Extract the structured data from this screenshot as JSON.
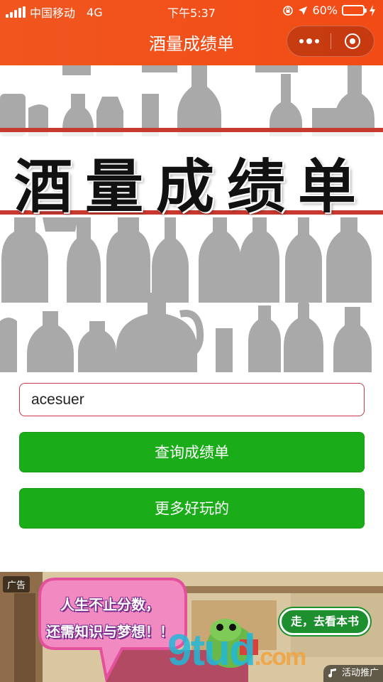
{
  "status_bar": {
    "carrier": "中国移动",
    "network": "4G",
    "time": "下午5:37",
    "battery_percent": "60%",
    "battery_level": 0.6
  },
  "nav": {
    "title": "酒量成绩单",
    "more_icon": "more-dots-icon",
    "close_icon": "target-close-icon"
  },
  "banner": {
    "heading": "酒量成绩单"
  },
  "form": {
    "input_value": "acesuer",
    "query_button": "查询成绩单",
    "more_button": "更多好玩的"
  },
  "ad": {
    "tag": "广告",
    "bubble_line1": "人生不止分数，",
    "bubble_line2": "还需知识与梦想！！",
    "cta": "走，去看本书",
    "watermark": "9tud",
    "watermark_suffix": ".com",
    "footer_label": "活动推广"
  },
  "colors": {
    "nav_bg": "#f24b16",
    "button_green": "#1aad19",
    "stripe_red": "#c8392f",
    "bottle_gray": "#a9a9a9"
  }
}
